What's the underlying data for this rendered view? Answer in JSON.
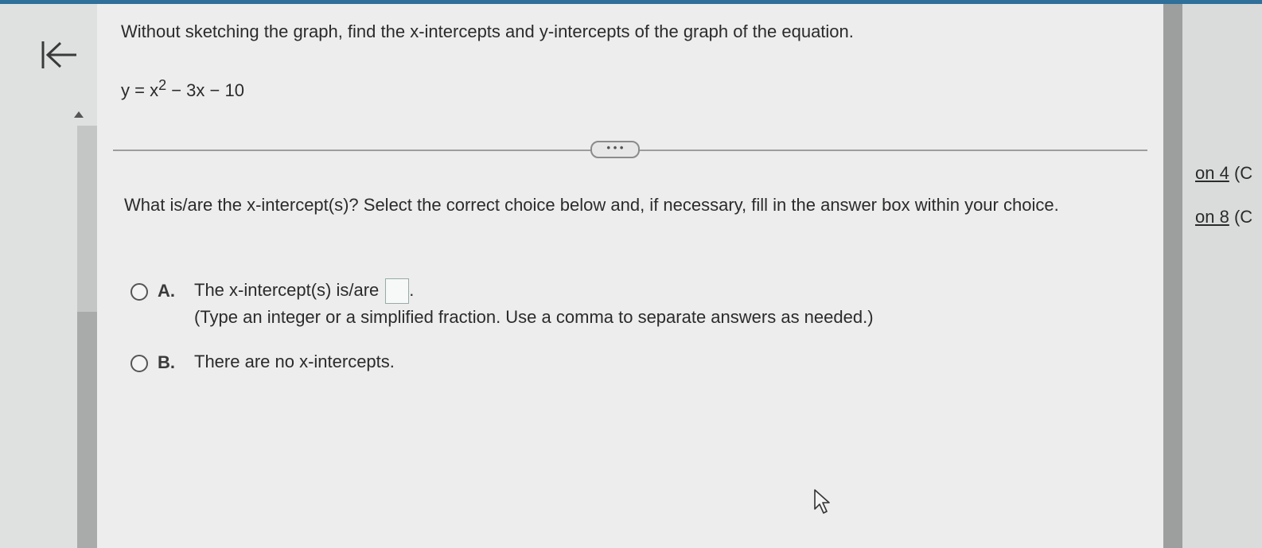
{
  "question": {
    "instruction": "Without sketching the graph, find the x-intercepts and y-intercepts of the graph of the equation.",
    "equation_lhs": "y = x",
    "equation_exponent": "2",
    "equation_rhs": " − 3x − 10"
  },
  "more_button": "• • •",
  "prompt": "What is/are the x-intercept(s)? Select the correct choice below and, if necessary, fill in the answer box within your choice.",
  "choices": [
    {
      "letter": "A.",
      "text": "The x-intercept(s) is/are",
      "answer_value": "",
      "hint": "(Type an integer or a simplified fraction. Use a comma to separate answers as needed.)"
    },
    {
      "letter": "B.",
      "text": "There are no x-intercepts."
    }
  ],
  "side_links": [
    {
      "underlined": "on 4",
      "suffix": " (C"
    },
    {
      "underlined": "on 8",
      "suffix": " (C"
    }
  ],
  "icons": {
    "back": "back-to-start-icon",
    "scroll_up": "scroll-up-arrow-icon",
    "cursor": "mouse-pointer-icon"
  },
  "colors": {
    "topbar": "#2f6f9a",
    "content_bg": "#ecedec"
  }
}
